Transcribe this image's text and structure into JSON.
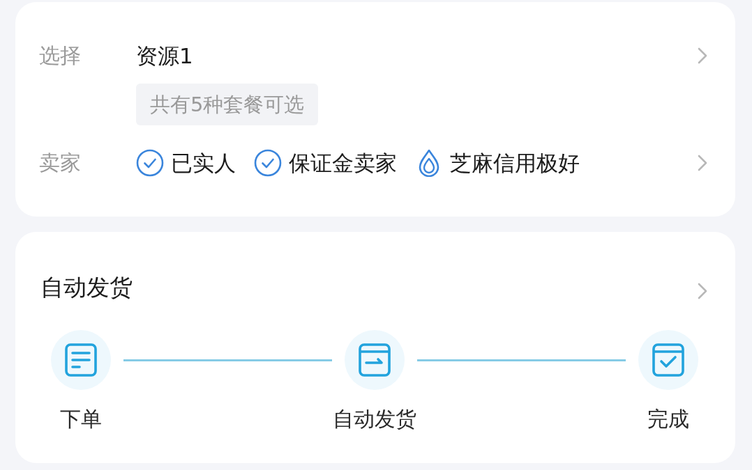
{
  "select": {
    "label": "选择",
    "value": "资源1",
    "tag": "共有5种套餐可选"
  },
  "seller": {
    "label": "卖家",
    "badges": [
      {
        "kind": "check",
        "text": "已实人"
      },
      {
        "kind": "check",
        "text": "保证金卖家"
      },
      {
        "kind": "sesame",
        "text": "芝麻信用极好"
      }
    ]
  },
  "delivery": {
    "title": "自动发货",
    "steps": [
      {
        "kind": "order",
        "label": "下单"
      },
      {
        "kind": "ship",
        "label": "自动发货"
      },
      {
        "kind": "done",
        "label": "完成"
      }
    ]
  }
}
